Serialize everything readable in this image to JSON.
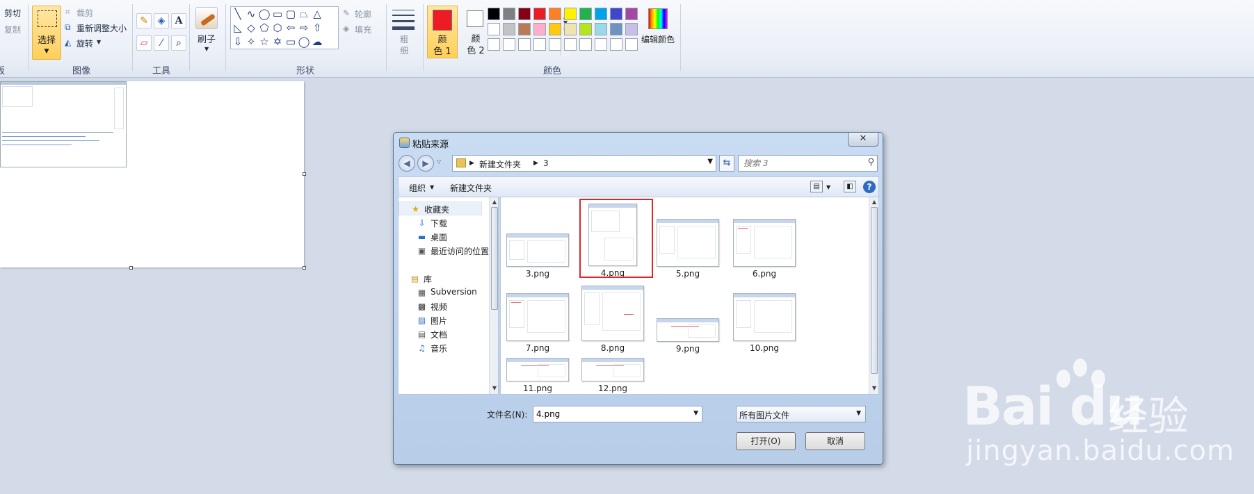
{
  "ribbon": {
    "clipboard": {
      "cut": "剪切",
      "copy": "复制",
      "group_label_partial": "板"
    },
    "image": {
      "select": "选择",
      "crop": "裁剪",
      "resize": "重新调整大小",
      "rotate": "旋转",
      "group_label": "图像"
    },
    "tools": {
      "group_label": "工具"
    },
    "brushes": {
      "label": "刷子"
    },
    "shapes": {
      "outline": "轮廓",
      "fill": "填充",
      "group_label": "形状"
    },
    "size": {
      "label_line1": "粗",
      "label_line2": "细"
    },
    "colors": {
      "color1_l1": "颜",
      "color1_l2": "色 1",
      "color2_l1": "颜",
      "color2_l2": "色 2",
      "edit": "编辑颜色",
      "group_label": "颜色",
      "color1_value": "#ed1c24",
      "color2_value": "#ffffff",
      "palette": [
        "#000000",
        "#7f7f7f",
        "#880015",
        "#ed1c24",
        "#ff7f27",
        "#fff200",
        "#22b14c",
        "#00a2e8",
        "#3f48cc",
        "#a349a4",
        "#ffffff",
        "#c3c3c3",
        "#b97a57",
        "#ffaec9",
        "#ffc90e",
        "#efe4b0",
        "#b5e61d",
        "#99d9ea",
        "#7092be",
        "#c8bfe7",
        "#ffffff",
        "#ffffff",
        "#ffffff",
        "#ffffff",
        "#ffffff",
        "#ffffff",
        "#ffffff",
        "#ffffff",
        "#ffffff",
        "#ffffff"
      ]
    }
  },
  "dialog": {
    "title": "粘贴来源",
    "close": "✕",
    "address": {
      "crumbs": [
        "新建文件夹",
        "3"
      ]
    },
    "search_placeholder": "搜索 3",
    "toolbar": {
      "organize": "组织",
      "new_folder": "新建文件夹"
    },
    "nav": {
      "favorites": "收藏夹",
      "favorites_items": [
        "下载",
        "桌面",
        "最近访问的位置"
      ],
      "libraries": "库",
      "library_items": [
        "Subversion",
        "视频",
        "图片",
        "文档",
        "音乐"
      ]
    },
    "files": [
      "3.png",
      "4.png",
      "5.png",
      "6.png",
      "7.png",
      "8.png",
      "9.png",
      "10.png",
      "11.png",
      "12.png"
    ],
    "selected_file": "4.png",
    "filename_label": "文件名(N):",
    "filename_value": "4.png",
    "filter_value": "所有图片文件",
    "open_button": "打开(O)",
    "cancel_button": "取消"
  },
  "watermark": {
    "brand_latin": "Bai du",
    "brand_cn": "经验",
    "url": "jingyan.baidu.com"
  }
}
